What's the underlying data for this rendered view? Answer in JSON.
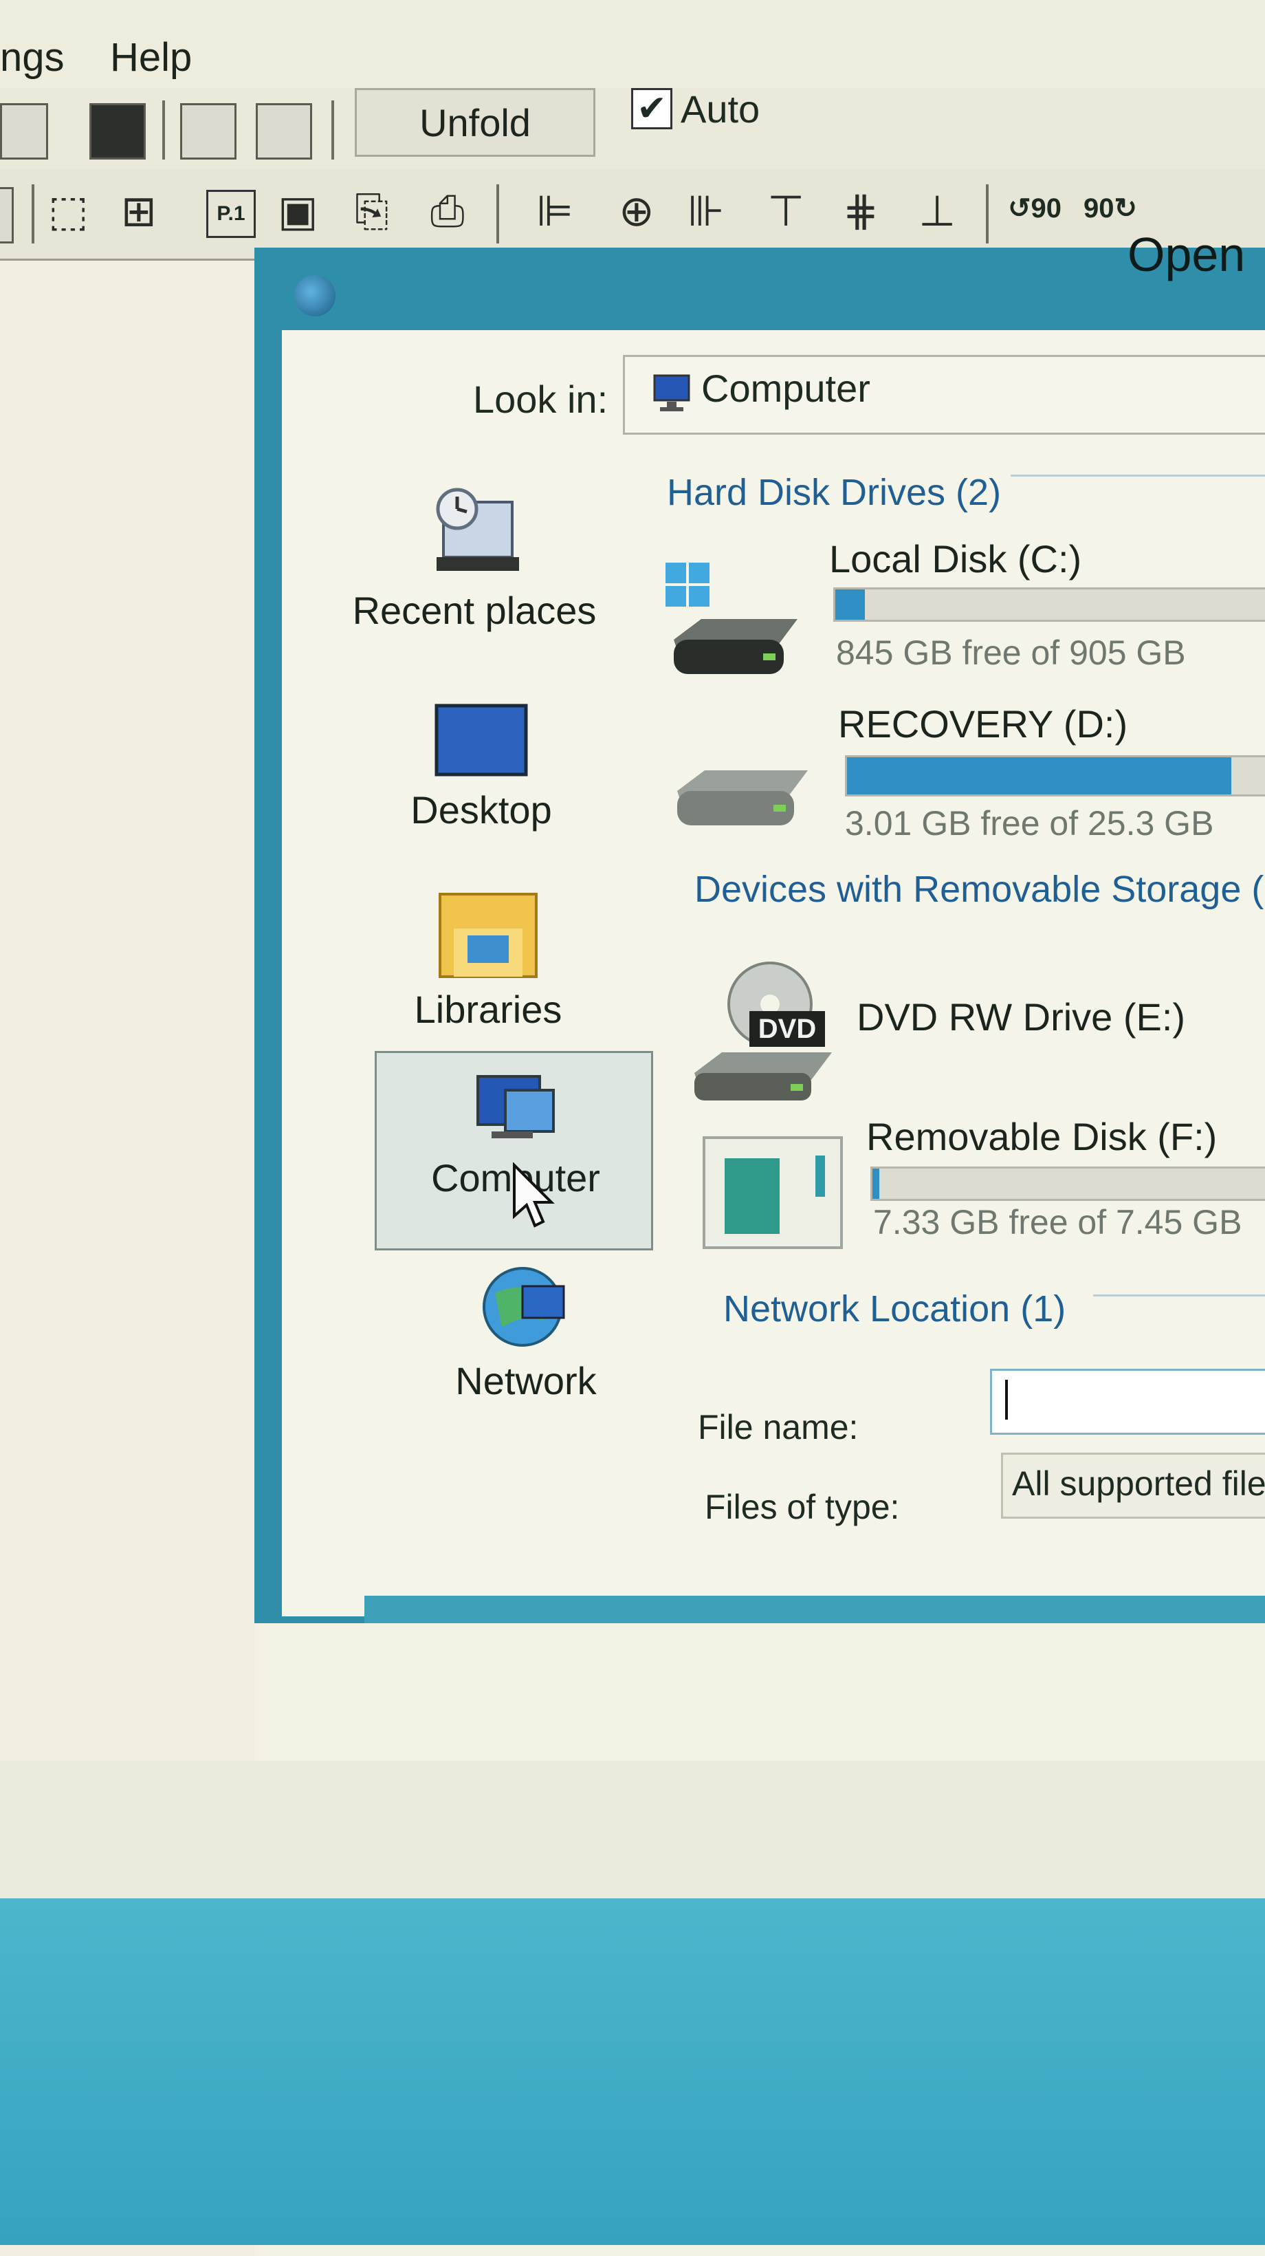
{
  "menu": {
    "settings_fragment": "ngs",
    "help": "Help"
  },
  "toolbar": {
    "unfold_label": "Unfold",
    "auto_label": "Auto",
    "auto_checked": true,
    "rotate_left_label": "90",
    "rotate_right_label": "90",
    "page_label": "P.1"
  },
  "dialog": {
    "title": "Open",
    "look_in_label": "Look in:",
    "look_in_value": "Computer"
  },
  "places": [
    {
      "label": "Recent places",
      "icon": "recent-places-icon"
    },
    {
      "label": "Desktop",
      "icon": "desktop-icon"
    },
    {
      "label": "Libraries",
      "icon": "libraries-icon"
    },
    {
      "label": "Computer",
      "icon": "computer-icon",
      "selected": true
    },
    {
      "label": "Network",
      "icon": "network-icon"
    }
  ],
  "sections": {
    "hard_disks": "Hard Disk Drives (2)",
    "removable": "Devices with Removable Storage (",
    "network": "Network Location (1)"
  },
  "drives": [
    {
      "name": "Local Disk (C:)",
      "free": "845 GB free of 905 GB",
      "used_fraction": 0.066
    },
    {
      "name": "RECOVERY (D:)",
      "free": "3.01 GB free of 25.3 GB",
      "used_fraction": 0.88
    },
    {
      "name": "DVD RW Drive (E:)",
      "badge": "DVD"
    },
    {
      "name": "Removable Disk (F:)",
      "free": "7.33 GB free of 7.45 GB",
      "used_fraction": 0.016
    }
  ],
  "file_name": {
    "label": "File name:",
    "value": ""
  },
  "file_type": {
    "label": "Files of type:",
    "value": "All supported files"
  },
  "colors": {
    "accent": "#2f8ec2",
    "frame": "#2f8eaa",
    "section_header": "#1f5f93"
  }
}
